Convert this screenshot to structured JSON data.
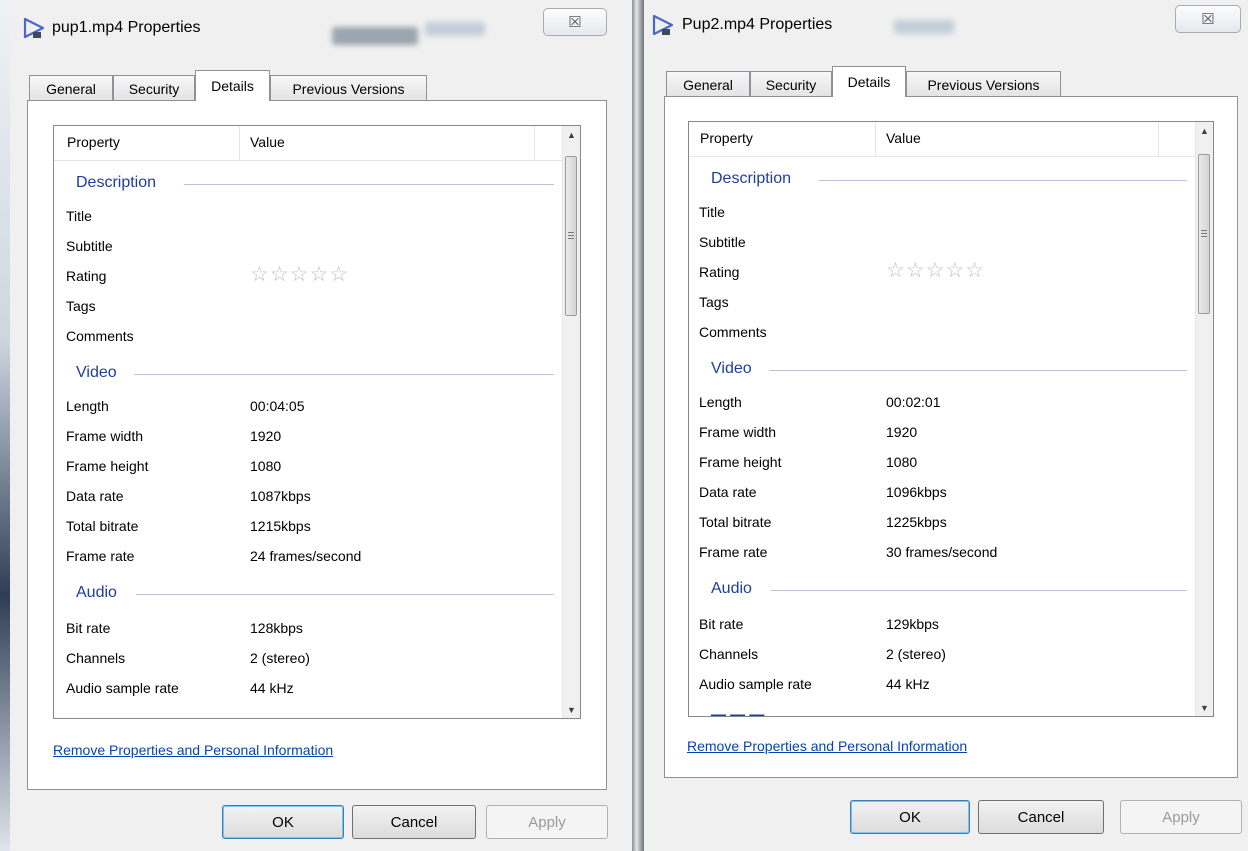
{
  "dialogs": [
    {
      "title": "pup1.mp4 Properties",
      "close_glyph": "☒",
      "tabs": [
        {
          "label": "General"
        },
        {
          "label": "Security"
        },
        {
          "label": "Details"
        },
        {
          "label": "Previous Versions"
        }
      ],
      "active_tab": "Details",
      "columns": {
        "property": "Property",
        "value": "Value"
      },
      "groups": {
        "description": "Description",
        "video": "Video",
        "audio": "Audio"
      },
      "description": {
        "title": "Title",
        "subtitle": "Subtitle",
        "rating": "Rating",
        "tags": "Tags",
        "comments": "Comments",
        "rating_stars": "☆☆☆☆☆"
      },
      "video": [
        {
          "name": "Length",
          "value": "00:04:05"
        },
        {
          "name": "Frame width",
          "value": "1920"
        },
        {
          "name": "Frame height",
          "value": "1080"
        },
        {
          "name": "Data rate",
          "value": "1087kbps"
        },
        {
          "name": "Total bitrate",
          "value": "1215kbps"
        },
        {
          "name": "Frame rate",
          "value": "24 frames/second"
        }
      ],
      "audio": [
        {
          "name": "Bit rate",
          "value": "128kbps"
        },
        {
          "name": "Channels",
          "value": "2 (stereo)"
        },
        {
          "name": "Audio sample rate",
          "value": "44 kHz"
        }
      ],
      "link": "Remove Properties and Personal Information",
      "buttons": {
        "ok": "OK",
        "cancel": "Cancel",
        "apply": "Apply"
      }
    },
    {
      "title": "Pup2.mp4 Properties",
      "close_glyph": "☒",
      "tabs": [
        {
          "label": "General"
        },
        {
          "label": "Security"
        },
        {
          "label": "Details"
        },
        {
          "label": "Previous Versions"
        }
      ],
      "active_tab": "Details",
      "columns": {
        "property": "Property",
        "value": "Value"
      },
      "groups": {
        "description": "Description",
        "video": "Video",
        "audio": "Audio"
      },
      "description": {
        "title": "Title",
        "subtitle": "Subtitle",
        "rating": "Rating",
        "tags": "Tags",
        "comments": "Comments",
        "rating_stars": "☆☆☆☆☆"
      },
      "video": [
        {
          "name": "Length",
          "value": "00:02:01"
        },
        {
          "name": "Frame width",
          "value": "1920"
        },
        {
          "name": "Frame height",
          "value": "1080"
        },
        {
          "name": "Data rate",
          "value": "1096kbps"
        },
        {
          "name": "Total bitrate",
          "value": "1225kbps"
        },
        {
          "name": "Frame rate",
          "value": "30 frames/second"
        }
      ],
      "audio": [
        {
          "name": "Bit rate",
          "value": "129kbps"
        },
        {
          "name": "Channels",
          "value": "2 (stereo)"
        },
        {
          "name": "Audio sample rate",
          "value": "44 kHz"
        }
      ],
      "link": "Remove Properties and Personal Information",
      "buttons": {
        "ok": "OK",
        "cancel": "Cancel",
        "apply": "Apply"
      }
    }
  ]
}
